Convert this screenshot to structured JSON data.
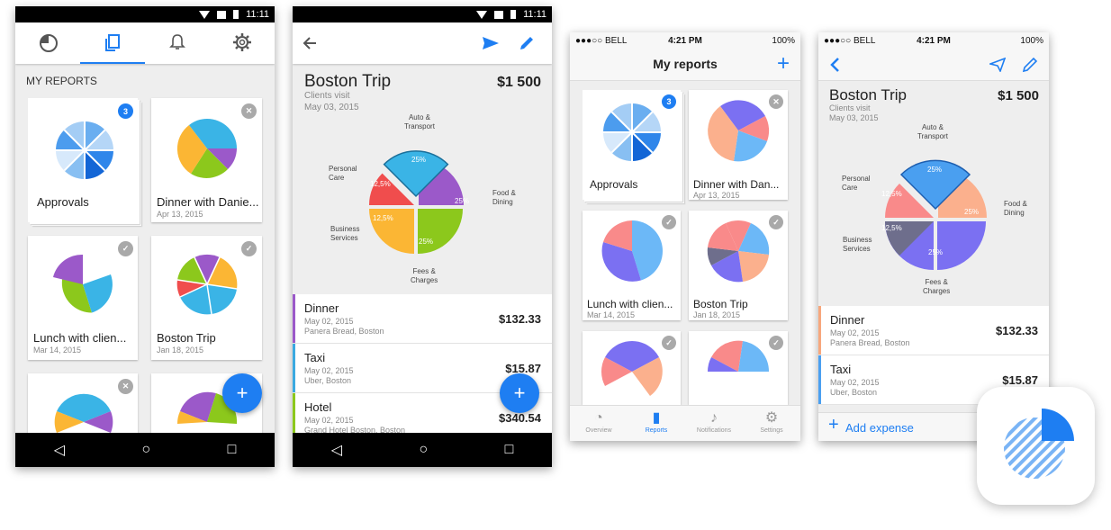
{
  "status": {
    "time": "11:11",
    "ios_carrier": "●●●○○ BELL",
    "ios_time": "4:21 PM",
    "ios_battery": "100%"
  },
  "screen1": {
    "section_title": "MY REPORTS",
    "cards": [
      {
        "title": "Approvals",
        "date": "",
        "badge": "3"
      },
      {
        "title": "Dinner with Danie...",
        "date": "Apr 13, 2015",
        "badge": "✕"
      },
      {
        "title": "Lunch with clien...",
        "date": "Mar 14, 2015",
        "badge": "✓"
      },
      {
        "title": "Boston Trip",
        "date": "Jan 18, 2015",
        "badge": "✓"
      },
      {
        "title": "",
        "date": "",
        "badge": "✕"
      },
      {
        "title": "",
        "date": "",
        "badge": ""
      }
    ],
    "fab": "+"
  },
  "screen2": {
    "trip_title": "Boston Trip",
    "subtitle": "Clients visit",
    "date": "May 03, 2015",
    "total": "$1 500",
    "pie_labels": {
      "auto": "Auto &\nTransport",
      "personal": "Personal\nCare",
      "food": "Food &\nDining",
      "business": "Business\nServices",
      "fees": "Fees &\nCharges"
    },
    "pie_values": {
      "auto": "25%",
      "personal": "12,5%",
      "business": "12,5%",
      "food": "25%",
      "fees": "25%"
    },
    "expenses": [
      {
        "name": "Dinner",
        "date": "May 02, 2015",
        "place": "Panera Bread, Boston",
        "amount": "$132.33",
        "color": "#9b59c9"
      },
      {
        "name": "Taxi",
        "date": "May 02, 2015",
        "place": "Uber, Boston",
        "amount": "$15.87",
        "color": "#3aa9e0"
      },
      {
        "name": "Hotel",
        "date": "May 02, 2015",
        "place": "Grand Hotel Boston, Boston",
        "amount": "$340.54",
        "color": "#8cc81c"
      }
    ],
    "fab": "+"
  },
  "screen3": {
    "nav_title": "My reports",
    "add": "+",
    "cards": [
      {
        "title": "Approvals",
        "date": "",
        "badge": "3"
      },
      {
        "title": "Dinner with Dan...",
        "date": "Apr 13, 2015",
        "badge": "✕"
      },
      {
        "title": "Lunch with clien...",
        "date": "Mar 14, 2015",
        "badge": "✓"
      },
      {
        "title": "Boston Trip",
        "date": "Jan 18, 2015",
        "badge": "✓"
      },
      {
        "title": "",
        "date": "",
        "badge": "✓"
      },
      {
        "title": "",
        "date": "",
        "badge": "✓"
      }
    ],
    "tabs": [
      "Overview",
      "Reports",
      "Notifications",
      "Settings"
    ]
  },
  "screen4": {
    "trip_title": "Boston Trip",
    "subtitle": "Clients visit",
    "date": "May 03, 2015",
    "total": "$1 500",
    "pie_values": {
      "auto": "25%",
      "personal": "12,5%",
      "business": "12,5%",
      "food": "25%",
      "fees": "25%"
    },
    "expenses": [
      {
        "name": "Dinner",
        "date": "May 02, 2015",
        "place": "Panera Bread, Boston",
        "amount": "$132.33",
        "color": "#f7a77c"
      },
      {
        "name": "Taxi",
        "date": "May 02, 2015",
        "place": "Uber, Boston",
        "amount": "$15.87",
        "color": "#4a9ff0"
      }
    ],
    "add_expense": "Add expense"
  },
  "colors": {
    "accent": "#1e7ef2"
  }
}
